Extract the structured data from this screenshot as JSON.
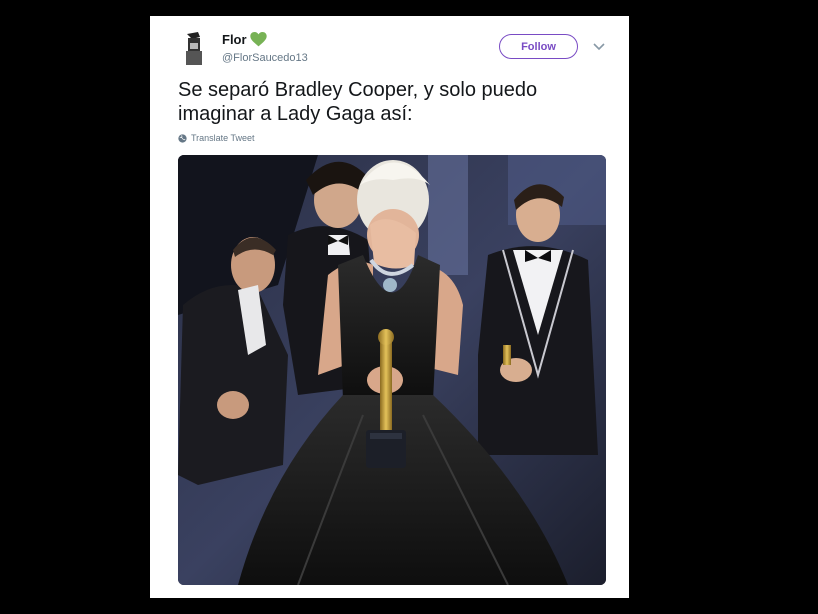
{
  "tweet": {
    "display_name": "Flor",
    "handle": "@FlorSaucedo13",
    "follow_label": "Follow",
    "text": "Se separó Bradley Cooper, y solo puedo imaginar a Lady Gaga así:",
    "translate_label": "Translate Tweet"
  },
  "icons": {
    "name_emoji": "green-heart-icon",
    "menu": "chevron-down-icon",
    "translate": "globe-icon"
  },
  "colors": {
    "follow_accent": "#794bc4",
    "heart": "#77b255",
    "secondary_text": "#657786",
    "primary_text": "#14171a"
  }
}
